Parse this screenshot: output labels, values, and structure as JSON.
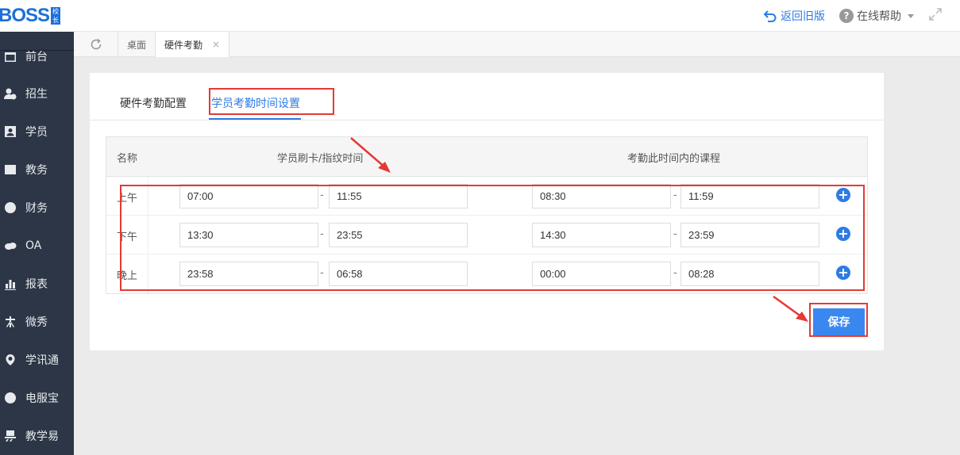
{
  "app": {
    "logo": "BOSS",
    "logo_badge": "校长"
  },
  "sidebar": {
    "items": [
      {
        "label": "前台",
        "icon": "calendar-icon"
      },
      {
        "label": "招生",
        "icon": "user-add-icon"
      },
      {
        "label": "学员",
        "icon": "student-icon"
      },
      {
        "label": "教务",
        "icon": "book-icon"
      },
      {
        "label": "财务",
        "icon": "yen-icon"
      },
      {
        "label": "OA",
        "icon": "chat-icon"
      },
      {
        "label": "报表",
        "icon": "bar-chart-icon"
      },
      {
        "label": "微秀",
        "icon": "xiu-icon"
      },
      {
        "label": "学讯通",
        "icon": "location-icon"
      },
      {
        "label": "电服宝",
        "icon": "phone-icon"
      },
      {
        "label": "教学易",
        "icon": "yi-icon"
      }
    ]
  },
  "header": {
    "back_old": "返回旧版",
    "help": "在线帮助"
  },
  "tabs": [
    {
      "label": "桌面"
    },
    {
      "label": "硬件考勤",
      "close": "×"
    }
  ],
  "subtabs": [
    {
      "label": "硬件考勤配置"
    },
    {
      "label": "学员考勤时间设置"
    }
  ],
  "table": {
    "headers": {
      "name": "名称",
      "swipe": "学员刷卡/指纹时间",
      "course": "考勤此时间内的课程"
    },
    "rows": [
      {
        "name": "上午",
        "swipe_start": "07:00",
        "swipe_end": "11:55",
        "course_start": "08:30",
        "course_end": "11:59"
      },
      {
        "name": "下午",
        "swipe_start": "13:30",
        "swipe_end": "23:55",
        "course_start": "14:30",
        "course_end": "23:59"
      },
      {
        "name": "晚上",
        "swipe_start": "23:58",
        "swipe_end": "06:58",
        "course_start": "00:00",
        "course_end": "08:28"
      }
    ],
    "dash": "-",
    "add": "+"
  },
  "save_label": "保存",
  "colors": {
    "accent": "#2d7be5",
    "highlight": "#e53935",
    "sidebar": "#2c3646"
  }
}
